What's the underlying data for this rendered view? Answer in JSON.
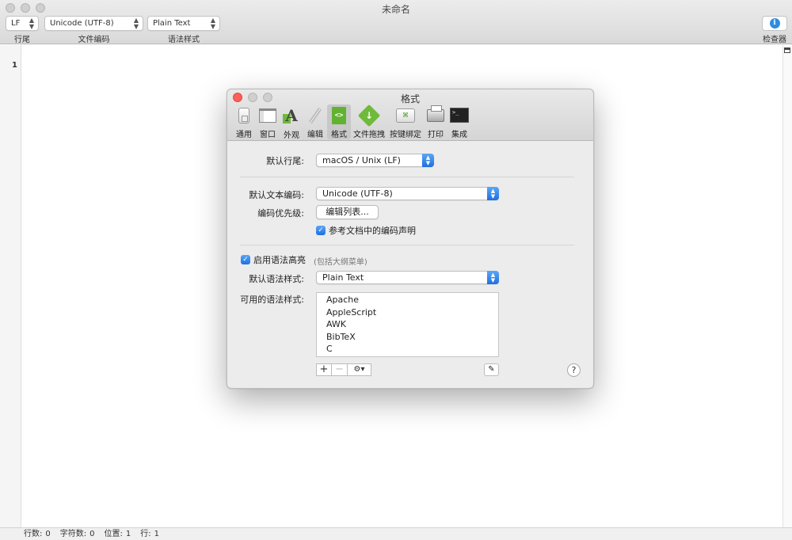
{
  "window": {
    "title": "未命名"
  },
  "toolbar": {
    "line_ending": {
      "value": "LF",
      "label": "行尾"
    },
    "encoding": {
      "value": "Unicode (UTF-8)",
      "label": "文件编码"
    },
    "syntax": {
      "value": "Plain Text",
      "label": "语法样式"
    },
    "inspector_label": "检查器"
  },
  "editor": {
    "line_number": "1"
  },
  "statusbar": {
    "lines_label": "行数:",
    "lines": "0",
    "chars_label": "字符数:",
    "chars": "0",
    "pos_label": "位置:",
    "pos": "1",
    "row_label": "行:",
    "row": "1"
  },
  "prefs": {
    "title": "格式",
    "tabs": [
      {
        "label": "通用",
        "icon": "switch-icon"
      },
      {
        "label": "窗口",
        "icon": "window-icon"
      },
      {
        "label": "外观",
        "icon": "appearance-icon"
      },
      {
        "label": "编辑",
        "icon": "pencil-icon"
      },
      {
        "label": "格式",
        "icon": "code-format-icon",
        "active": true
      },
      {
        "label": "文件拖拽",
        "icon": "file-drop-icon"
      },
      {
        "label": "按键绑定",
        "icon": "keyboard-icon"
      },
      {
        "label": "打印",
        "icon": "printer-icon"
      },
      {
        "label": "集成",
        "icon": "terminal-icon"
      }
    ],
    "default_line_ending_label": "默认行尾:",
    "default_line_ending_value": "macOS / Unix (LF)",
    "default_encoding_label": "默认文本编码:",
    "default_encoding_value": "Unicode (UTF-8)",
    "encoding_priority_label": "编码优先级:",
    "edit_list_button": "编辑列表...",
    "refer_encoding_checkbox": "参考文档中的编码声明",
    "enable_syntax_checkbox": "启用语法高亮",
    "syntax_hint": "(包括大纲菜单)",
    "default_syntax_label": "默认语法样式:",
    "default_syntax_value": "Plain Text",
    "available_syntax_label": "可用的语法样式:",
    "available_syntaxes": [
      "Apache",
      "AppleScript",
      "AWK",
      "BibTeX",
      "C"
    ],
    "add_symbol": "+",
    "remove_symbol": "−",
    "help_symbol": "?"
  },
  "colors": {
    "accent": "#1e6fe0",
    "close": "#fc5f57",
    "format_green": "#62b232"
  }
}
